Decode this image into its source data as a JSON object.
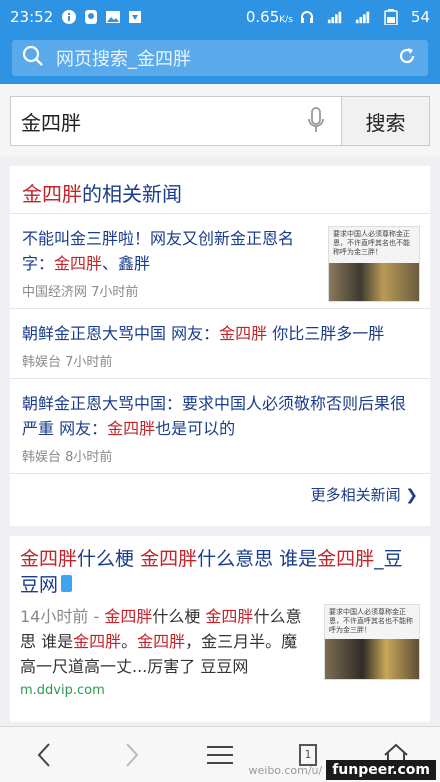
{
  "status_bar": {
    "time": "23:52",
    "net_speed": "0.65",
    "net_unit": "K/s",
    "battery": "54"
  },
  "browser": {
    "url_text": "网页搜索_金四胖"
  },
  "search": {
    "query": "金四胖",
    "button_label": "搜索"
  },
  "news": {
    "heading_highlight": "金四胖",
    "heading_rest": "的相关新闻",
    "items": [
      {
        "title_pre": "不能叫金三胖啦！网友又创新金正恩名字：",
        "title_hl1": "金四胖",
        "title_mid": "、鑫胖",
        "source": "中国经济网",
        "time": "7小时前",
        "thumb_text": "要求中国人必须尊称金正恩，不许直呼其名也不能称呼为金三胖！"
      },
      {
        "title_pre": "朝鲜金正恩大骂中国 网友：",
        "title_hl1": "金四胖",
        "title_mid": " 你比三胖多一胖",
        "source": "韩娱台",
        "time": "7小时前"
      },
      {
        "title_pre": "朝鲜金正恩大骂中国：要求中国人必须敬称否则后果很严重 网友：",
        "title_hl1": "金四胖",
        "title_mid": "也是可以的",
        "source": "韩娱台",
        "time": "8小时前"
      }
    ],
    "more_label": "更多相关新闻 ❯"
  },
  "result": {
    "title": {
      "hl1": "金四胖",
      "t1": "什么梗 ",
      "hl2": "金四胖",
      "t2": "什么意思 谁是",
      "hl3": "金四胖",
      "t3": "_豆豆网"
    },
    "desc": {
      "time": "14小时前 - ",
      "hl1": "金四胖",
      "t1": "什么梗 ",
      "hl2": "金四胖",
      "t2": "什么意思 谁是",
      "hl3": "金四胖",
      "t3": "。",
      "hl4": "金四胖",
      "t4": "，金三月半。魔高一尺道高一丈...厉害了 豆豆网"
    },
    "thumb_text": "要求中国人必须尊称金正恩，不许直呼其名也不能称呼为金三胖！",
    "domain": "m.ddvip.com"
  },
  "toolbar": {
    "tab_count": "1"
  },
  "watermark": {
    "text": "weibo.com/u/",
    "brand": "funpeer.com"
  },
  "colors": {
    "accent": "#2f93e4",
    "link": "#1a3c8c",
    "highlight": "#c0252c",
    "domain": "#2b9a4e"
  }
}
